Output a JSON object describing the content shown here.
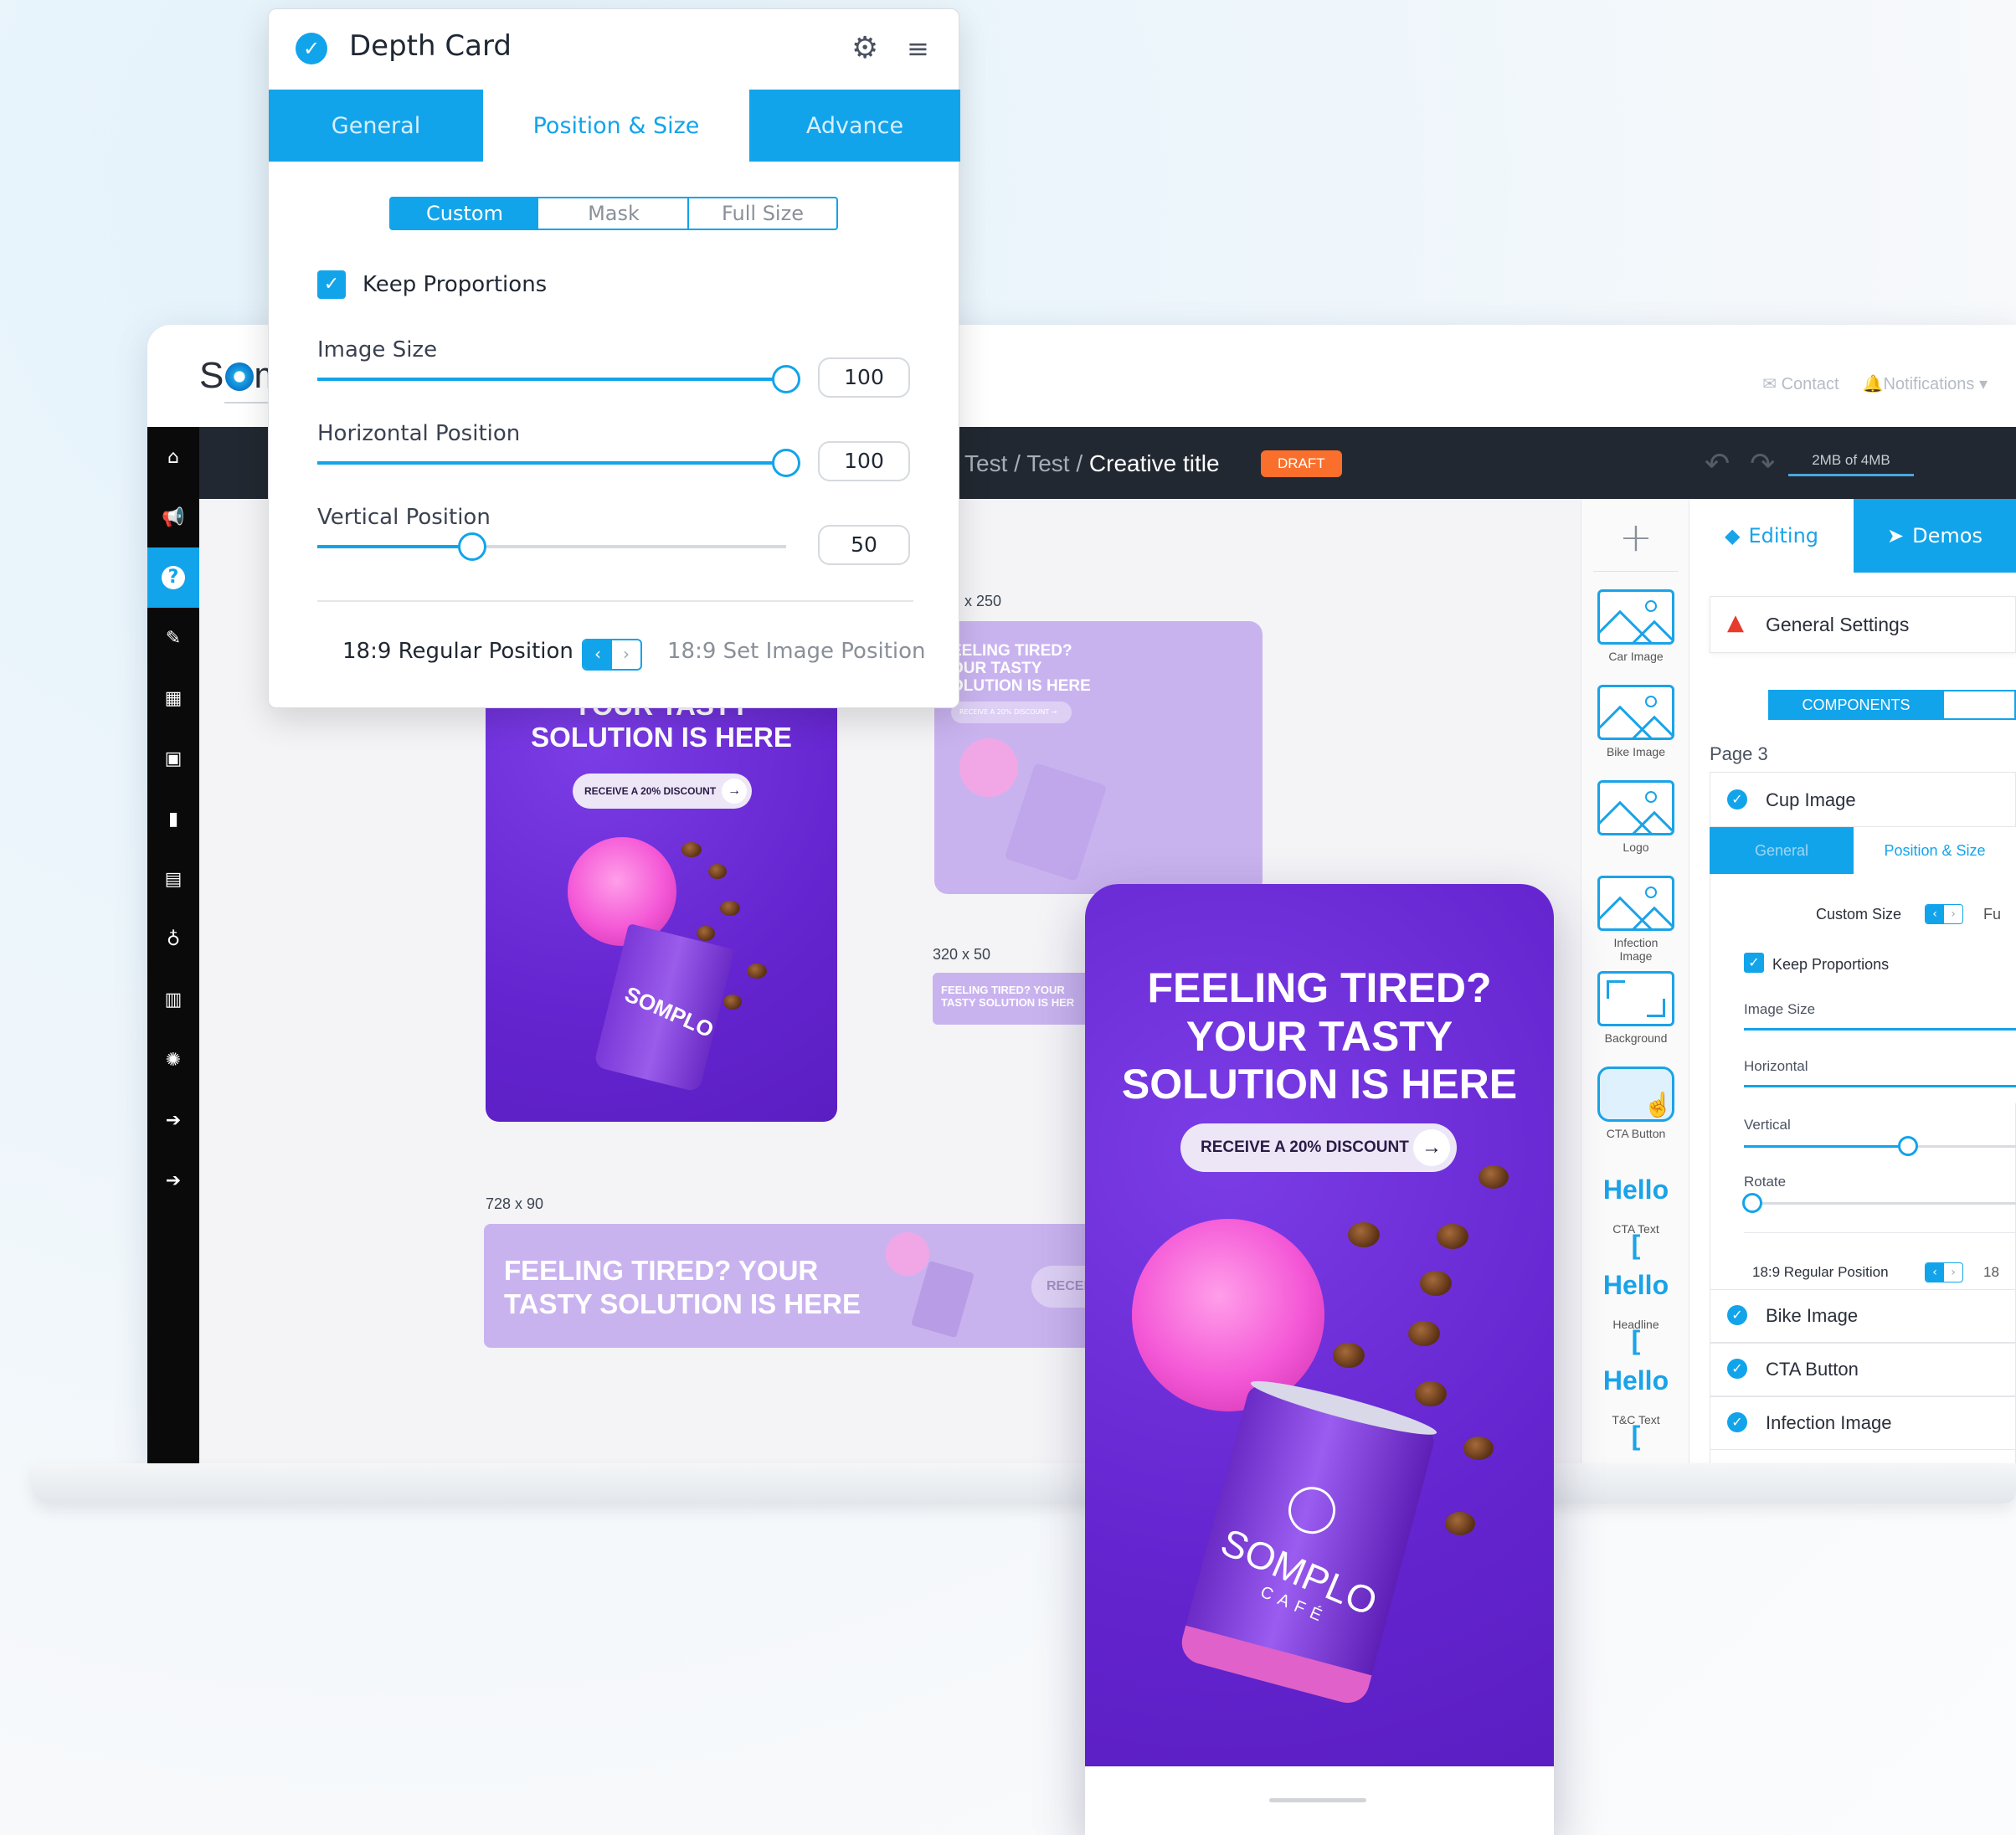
{
  "app": {
    "logo_text": "Som",
    "top_links": [
      "Contact",
      "Notifications"
    ],
    "breadcrumb": {
      "part1": "Test",
      "sep1": " / ",
      "part2": "Test",
      "sep2": " / ",
      "title": "Creative title"
    },
    "status_badge": "DRAFT",
    "storage": "2MB of 4MB"
  },
  "canvas": {
    "sizes": {
      "medium": "x 250",
      "small": "320 x 50",
      "leaderboard": "728 x 90"
    },
    "banner_headline_lines": [
      "FEELING TIRED?",
      "YOUR TASTY",
      "SOLUTION IS HERE"
    ],
    "tall_visible_lines": [
      "YOUR TASTY",
      "SOLUTION IS HERE"
    ],
    "medium_lines": [
      "EELING TIRED?",
      "OUR TASTY",
      "OLUTION IS HERE"
    ],
    "small_lines": [
      "FEELING TIRED? YOUR",
      "TASTY SOLUTION IS HER"
    ],
    "leader_lines": [
      "FEELING TIRED? YOUR",
      "TASTY SOLUTION IS HERE"
    ],
    "cta": "RECEIVE A 20% DISCOUNT",
    "cta_small": "RECEIVE A 20% DISCOUNT",
    "leader_cta": "RECEI",
    "brand": "SOMPLO",
    "brand_sub": "CAFÉ"
  },
  "components": [
    {
      "label": "Car Image",
      "icon": "image-icon"
    },
    {
      "label": "Bike Image",
      "icon": "image-icon"
    },
    {
      "label": "Logo",
      "icon": "image-icon"
    },
    {
      "label": "Infection Image",
      "icon": "image-icon"
    },
    {
      "label": "Background",
      "icon": "background-icon"
    },
    {
      "label": "CTA Button",
      "icon": "cta-button-icon"
    },
    {
      "label": "CTA Text",
      "icon": "hello-text-icon",
      "text": "Hello"
    },
    {
      "label": "Headline",
      "icon": "hello-text-icon",
      "text": "Hello"
    },
    {
      "label": "T&C Text",
      "icon": "hello-text-icon",
      "text": "Hello"
    }
  ],
  "right_panel": {
    "tab_editing": "Editing",
    "tab_demos": "Demos",
    "general_settings": "General Settings",
    "components_btn": "COMPONENTS",
    "page_label": "Page 3",
    "cup_image": "Cup Image",
    "sub_tabs": [
      "General",
      "Position & Size"
    ],
    "custom_size": "Custom Size",
    "custom_size_trailing": "Fu",
    "keep_proportions": "Keep Proportions",
    "sliders": [
      "Image Size",
      "Horizontal",
      "Vertical",
      "Rotate"
    ],
    "regular_position": "18:9 Regular Position",
    "regular_position_trailing": "18",
    "items": [
      "Bike Image",
      "CTA Button",
      "Infection Image"
    ]
  },
  "depth_card": {
    "title": "Depth Card",
    "tabs": [
      "General",
      "Position & Size",
      "Advance"
    ],
    "active_tab": "Position & Size",
    "segments": [
      "Custom",
      "Mask",
      "Full Size"
    ],
    "active_segment": "Custom",
    "keep_proportions": "Keep Proportions",
    "keep_proportions_checked": true,
    "sliders": [
      {
        "label": "Image Size",
        "value": "100",
        "percent": 100
      },
      {
        "label": "Horizontal Position",
        "value": "100",
        "percent": 100
      },
      {
        "label": "Vertical Position",
        "value": "50",
        "percent": 33
      }
    ],
    "regular_position": "18:9 Regular Position",
    "set_position": "18:9 Set Image Position"
  },
  "colors": {
    "accent": "#12a4ea",
    "banner_purple": "#6d2fd8",
    "draft": "#f96f2b",
    "topbar": "#222831"
  }
}
